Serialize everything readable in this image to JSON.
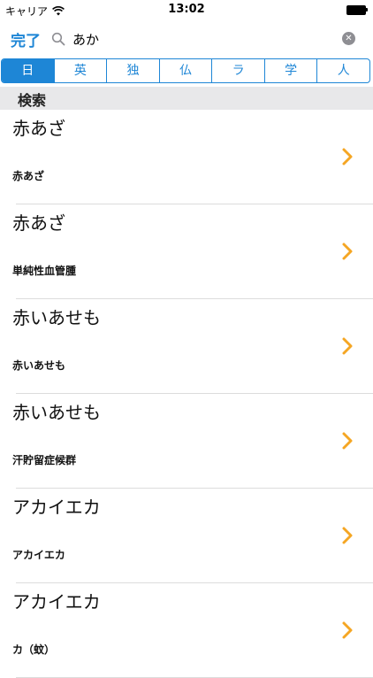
{
  "status_bar": {
    "carrier": "キャリア",
    "time": "13:02"
  },
  "search": {
    "done_label": "完了",
    "query": "あか"
  },
  "segments": [
    {
      "label": "日",
      "active": true
    },
    {
      "label": "英",
      "active": false
    },
    {
      "label": "独",
      "active": false
    },
    {
      "label": "仏",
      "active": false
    },
    {
      "label": "ラ",
      "active": false
    },
    {
      "label": "学",
      "active": false
    },
    {
      "label": "人",
      "active": false
    }
  ],
  "section": {
    "title": "検索"
  },
  "results": [
    {
      "title": "赤あざ",
      "subtitle": "赤あざ"
    },
    {
      "title": "赤あざ",
      "subtitle": "単純性血管腫"
    },
    {
      "title": "赤いあせも",
      "subtitle": "赤いあせも"
    },
    {
      "title": "赤いあせも",
      "subtitle": "汗貯留症候群"
    },
    {
      "title": "アカイエカ",
      "subtitle": "アカイエカ"
    },
    {
      "title": "アカイエカ",
      "subtitle": "カ（蚊）"
    }
  ],
  "colors": {
    "accent": "#1e86d6",
    "chevron": "#f5a623",
    "section_bg": "#e8e8ea"
  }
}
